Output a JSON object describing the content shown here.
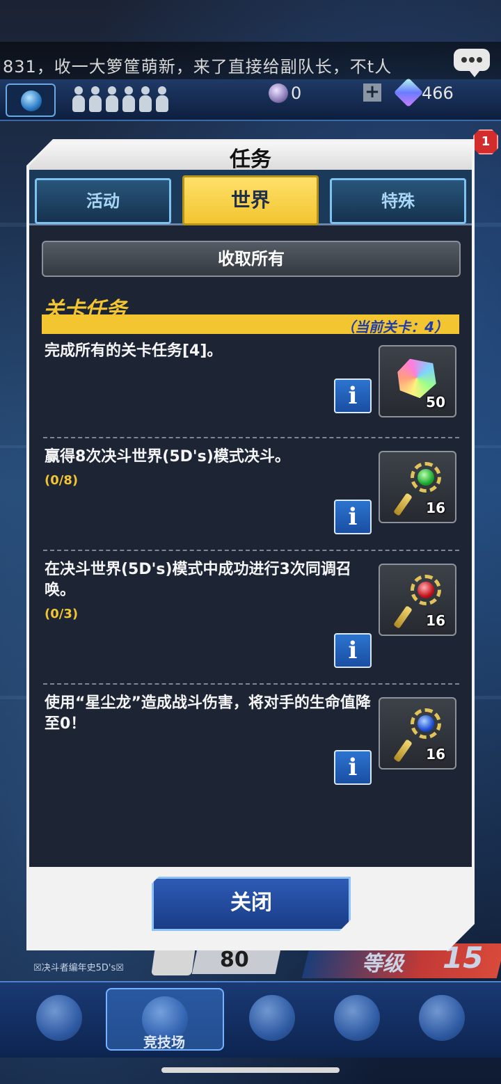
{
  "chat": {
    "message": "831，收一大箩筐萌新，来了直接给副队长，不t人",
    "icon": "chat-bubble-icon"
  },
  "status": {
    "gem_count": "0",
    "plus_label": "+",
    "crystal_count": "466",
    "notification_count": "1"
  },
  "dialog": {
    "title": "任务",
    "tabs": [
      {
        "label": "活动",
        "active": false
      },
      {
        "label": "世界",
        "active": true
      },
      {
        "label": "特殊",
        "active": false
      }
    ],
    "collect_all_label": "收取所有",
    "section_title": "关卡任务",
    "stage_info": "（当前关卡：4）",
    "missions": [
      {
        "text": "完成所有的关卡任务[4]。",
        "progress": "",
        "reward_icon": "rainbow-gem-icon",
        "reward_count": "50"
      },
      {
        "text": "赢得8次决斗世界(5D's)模式决斗。",
        "progress": "(0/8)",
        "reward_icon": "green-key-icon",
        "reward_count": "16"
      },
      {
        "text": "在决斗世界(5D's)模式中成功进行3次同调召唤。",
        "progress": "(0/3)",
        "reward_icon": "red-key-icon",
        "reward_count": "16"
      },
      {
        "text": "使用“星尘龙”造成战斗伤害，将对手的生命值降至0！",
        "progress": "",
        "reward_icon": "blue-key-icon",
        "reward_count": "16"
      }
    ],
    "info_label": "i",
    "close_label": "关闭"
  },
  "background": {
    "level_value": "80",
    "rank_label": "等级",
    "rank_value": "15",
    "profile_caption": "☒决斗者编年史5D's☒",
    "nav_arena_label": "竞技场"
  },
  "colors": {
    "accent_yellow": "#f2c531",
    "panel_dark": "#1d2535",
    "button_blue": "#1a4ea3"
  }
}
